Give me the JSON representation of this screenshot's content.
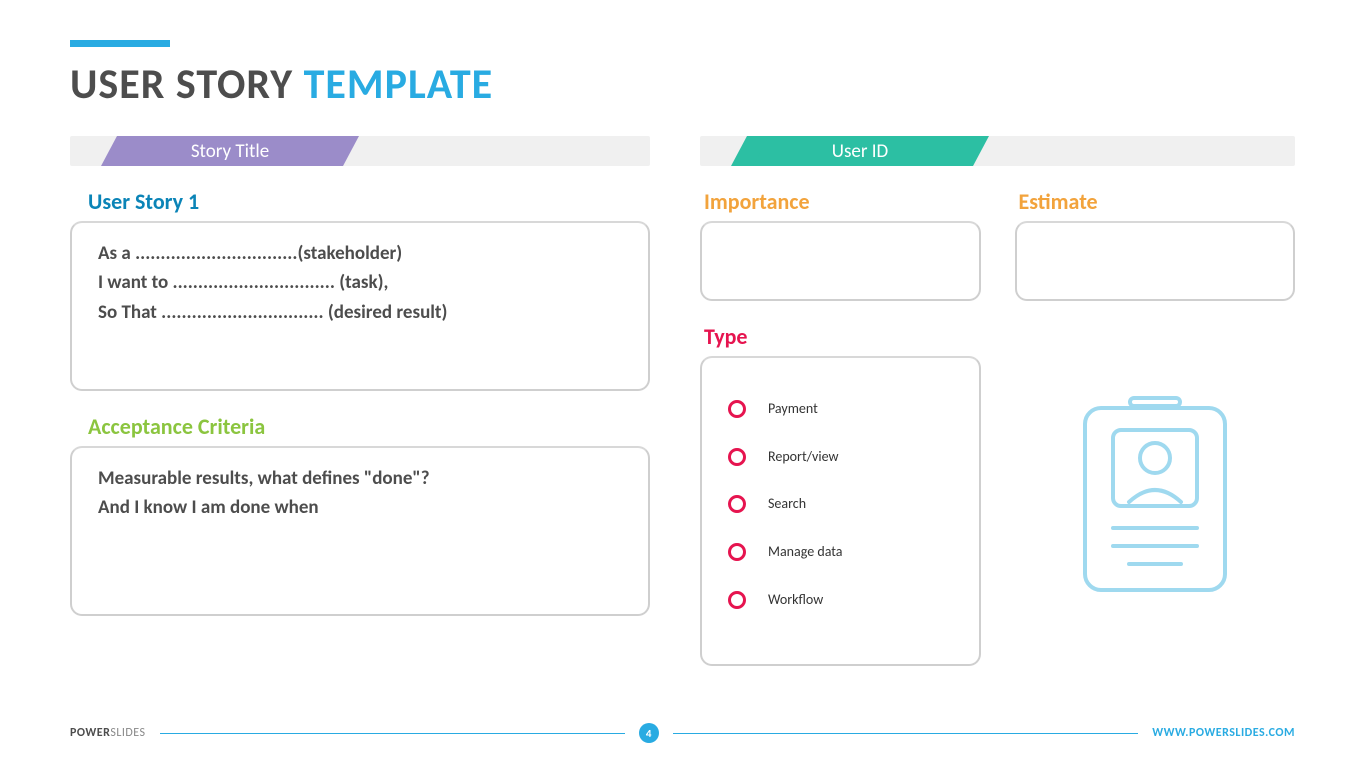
{
  "title": {
    "main": "USER STORY",
    "accent": "TEMPLATE"
  },
  "left": {
    "ribbon_label": "Story Title",
    "story_heading": "User Story 1",
    "story_body": {
      "l1": "As a ................................(stakeholder)",
      "l2": "I want to ................................ (task),",
      "l3": "So That ................................ (desired result)"
    },
    "acceptance_heading": "Acceptance Criteria",
    "acceptance_body": {
      "l1": "Measurable results, what defines \"done\"?",
      "l2": "And I know I am done  when"
    }
  },
  "right": {
    "ribbon_label": "User ID",
    "importance_label": "Importance",
    "estimate_label": "Estimate",
    "type_label": "Type",
    "types": {
      "0": "Payment",
      "1": "Report/view",
      "2": "Search",
      "3": "Manage data",
      "4": "Workflow"
    }
  },
  "footer": {
    "brand_bold": "POWER",
    "brand_light": "SLIDES",
    "page_number": "4",
    "site": "WWW.POWERSLIDES.COM"
  }
}
